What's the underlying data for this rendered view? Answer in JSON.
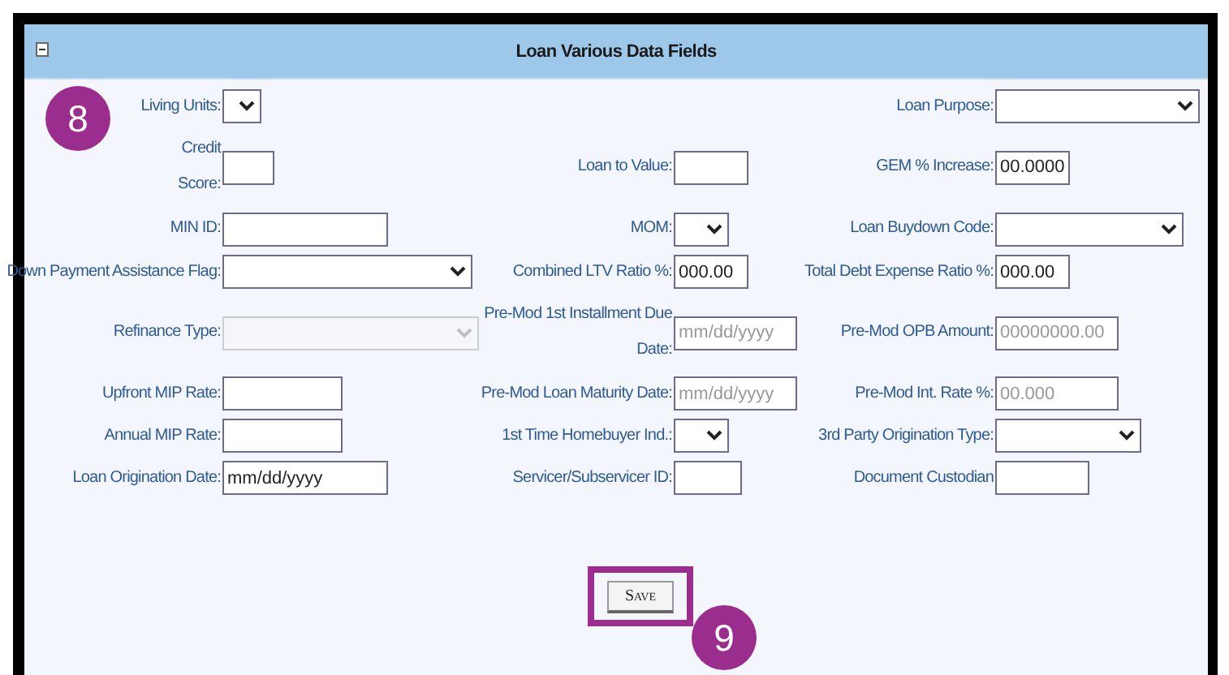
{
  "panel": {
    "title": "Loan Various Data Fields"
  },
  "rows": [
    {
      "cells": [
        {
          "label": "Living Units:",
          "kind": "select",
          "disabled": false
        },
        null,
        {
          "label": "Loan Purpose:",
          "kind": "select",
          "disabled": false
        }
      ]
    },
    {
      "cells": [
        {
          "label": "Credit Score:",
          "kind": "text",
          "disabled": false
        },
        {
          "label": "Loan to Value:",
          "kind": "text",
          "disabled": false
        },
        {
          "label": "GEM % Increase:",
          "kind": "text",
          "value": "00.0000",
          "disabled": false
        }
      ]
    },
    {
      "cells": [
        {
          "label": "MIN ID:",
          "kind": "text",
          "disabled": false
        },
        {
          "label": "MOM:",
          "kind": "select",
          "disabled": false
        },
        {
          "label": "Loan Buydown Code:",
          "kind": "select",
          "disabled": false
        }
      ]
    },
    {
      "cells": [
        {
          "label": "Down Payment Assistance Flag:",
          "kind": "select",
          "disabled": false
        },
        {
          "label": "Combined LTV Ratio %:",
          "kind": "text",
          "value": "000.00",
          "disabled": false
        },
        {
          "label": "Total Debt Expense Ratio %:",
          "kind": "text",
          "value": "000.00",
          "disabled": false
        }
      ]
    },
    {
      "cells": [
        {
          "label": "Refinance Type:",
          "kind": "select",
          "disabled": true
        },
        {
          "label": "Pre-Mod 1st Installment Due Date:",
          "kind": "text",
          "placeholder": "mm/dd/yyyy",
          "disabled": false
        },
        {
          "label": "Pre-Mod OPB Amount:",
          "kind": "text",
          "placeholder": "00000000.00",
          "disabled": false
        }
      ]
    },
    {
      "cells": [
        {
          "label": "Upfront MIP Rate:",
          "kind": "text",
          "disabled": false
        },
        {
          "label": "Pre-Mod Loan Maturity Date:",
          "kind": "text",
          "placeholder": "mm/dd/yyyy",
          "disabled": false
        },
        {
          "label": "Pre-Mod Int. Rate %:",
          "kind": "text",
          "placeholder": "00.000",
          "disabled": false
        }
      ]
    },
    {
      "cells": [
        {
          "label": "Annual MIP Rate:",
          "kind": "text",
          "disabled": false
        },
        {
          "label": "1st Time Homebuyer Ind.:",
          "kind": "select",
          "disabled": false
        },
        {
          "label": "3rd Party Origination Type:",
          "kind": "select",
          "disabled": false
        }
      ]
    },
    {
      "cells": [
        {
          "label": "Loan Origination Date:",
          "kind": "text",
          "value": "mm/dd/yyyy",
          "disabled": false
        },
        {
          "label": "Servicer/Subservicer ID:",
          "kind": "text",
          "disabled": false
        },
        {
          "label": "Document Custodian",
          "kind": "text",
          "disabled": false
        }
      ]
    }
  ],
  "save_button": {
    "label": "Save"
  },
  "callouts": [
    "8",
    "9"
  ]
}
